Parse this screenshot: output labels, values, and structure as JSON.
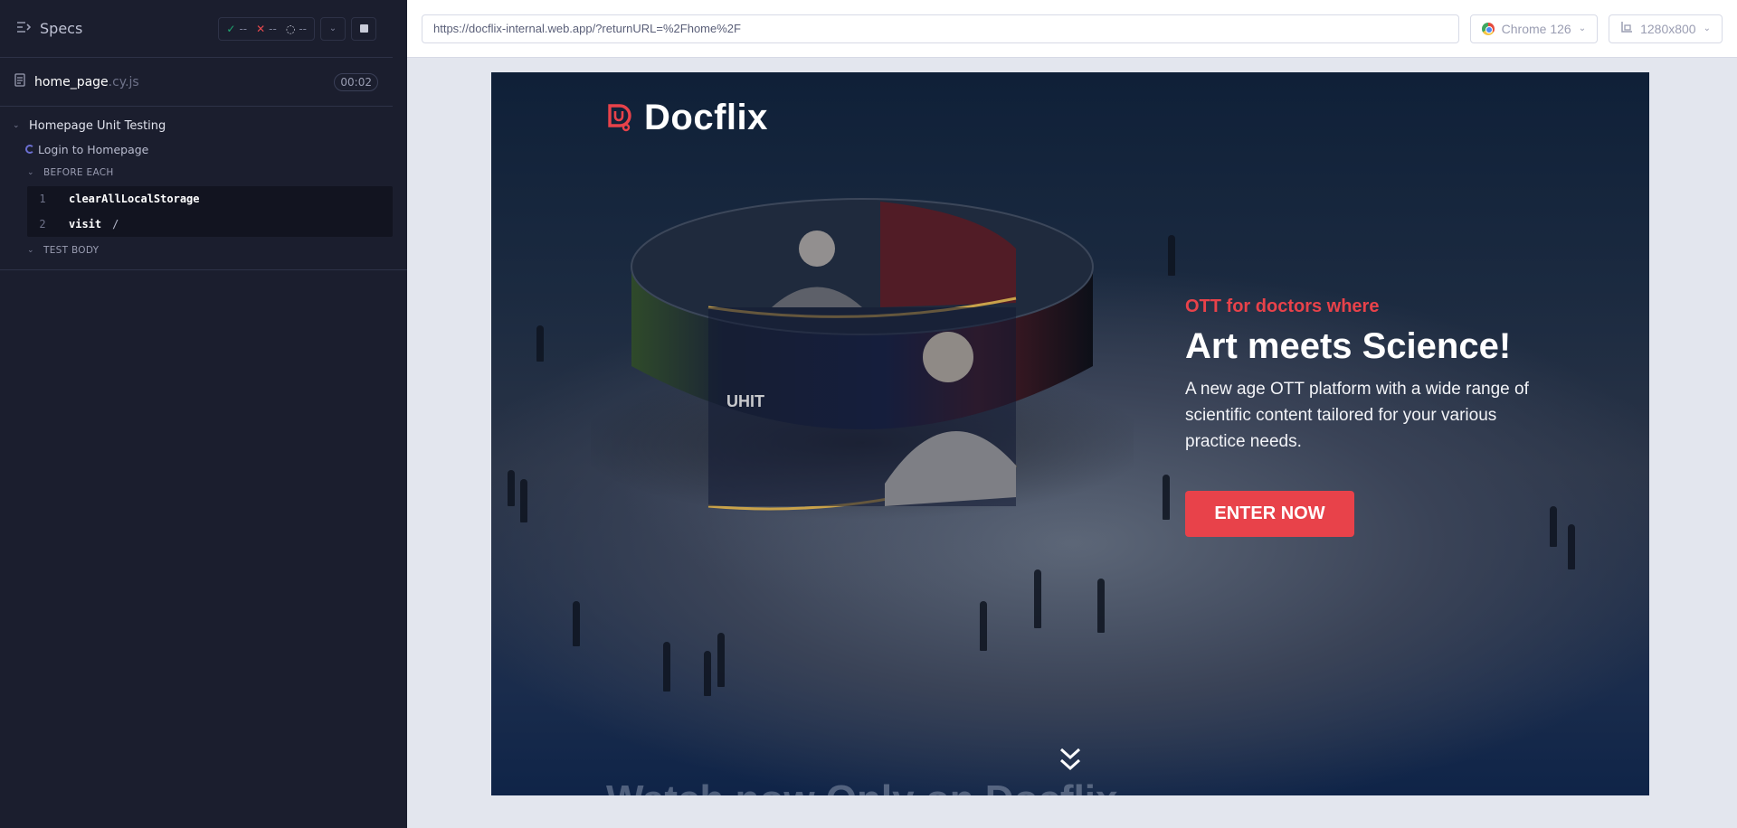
{
  "reporter": {
    "title": "Specs",
    "stats": {
      "passed": "--",
      "failed": "--",
      "pending": "--"
    },
    "file": {
      "name": "home_page",
      "ext": ".cy.js",
      "timer": "00:02"
    },
    "suite": "Homepage Unit Testing",
    "test": "Login to Homepage",
    "hooks": {
      "before_each": "BEFORE EACH",
      "test_body": "TEST BODY"
    },
    "commands": [
      {
        "num": "1",
        "name": "clearAllLocalStorage",
        "arg": ""
      },
      {
        "num": "2",
        "name": "visit",
        "arg": "/"
      }
    ],
    "colors": {
      "pass": "#1fa971",
      "fail": "#e5484d",
      "bg": "#1b1e2e"
    }
  },
  "topbar": {
    "url": "https://docflix-internal.web.app/?returnURL=%2Fhome%2F",
    "browser": "Chrome 126",
    "viewport": "1280x800"
  },
  "aut": {
    "brand": "Docflix",
    "kicker": "OTT for doctors where",
    "headline": "Art meets Science!",
    "subtext": "A new age OTT platform with a wide range of scientific content tailored for your various practice needs.",
    "cta": "ENTER NOW",
    "bottom_title": "Watch now Only on Docflix",
    "colors": {
      "accent": "#e8424a"
    }
  }
}
